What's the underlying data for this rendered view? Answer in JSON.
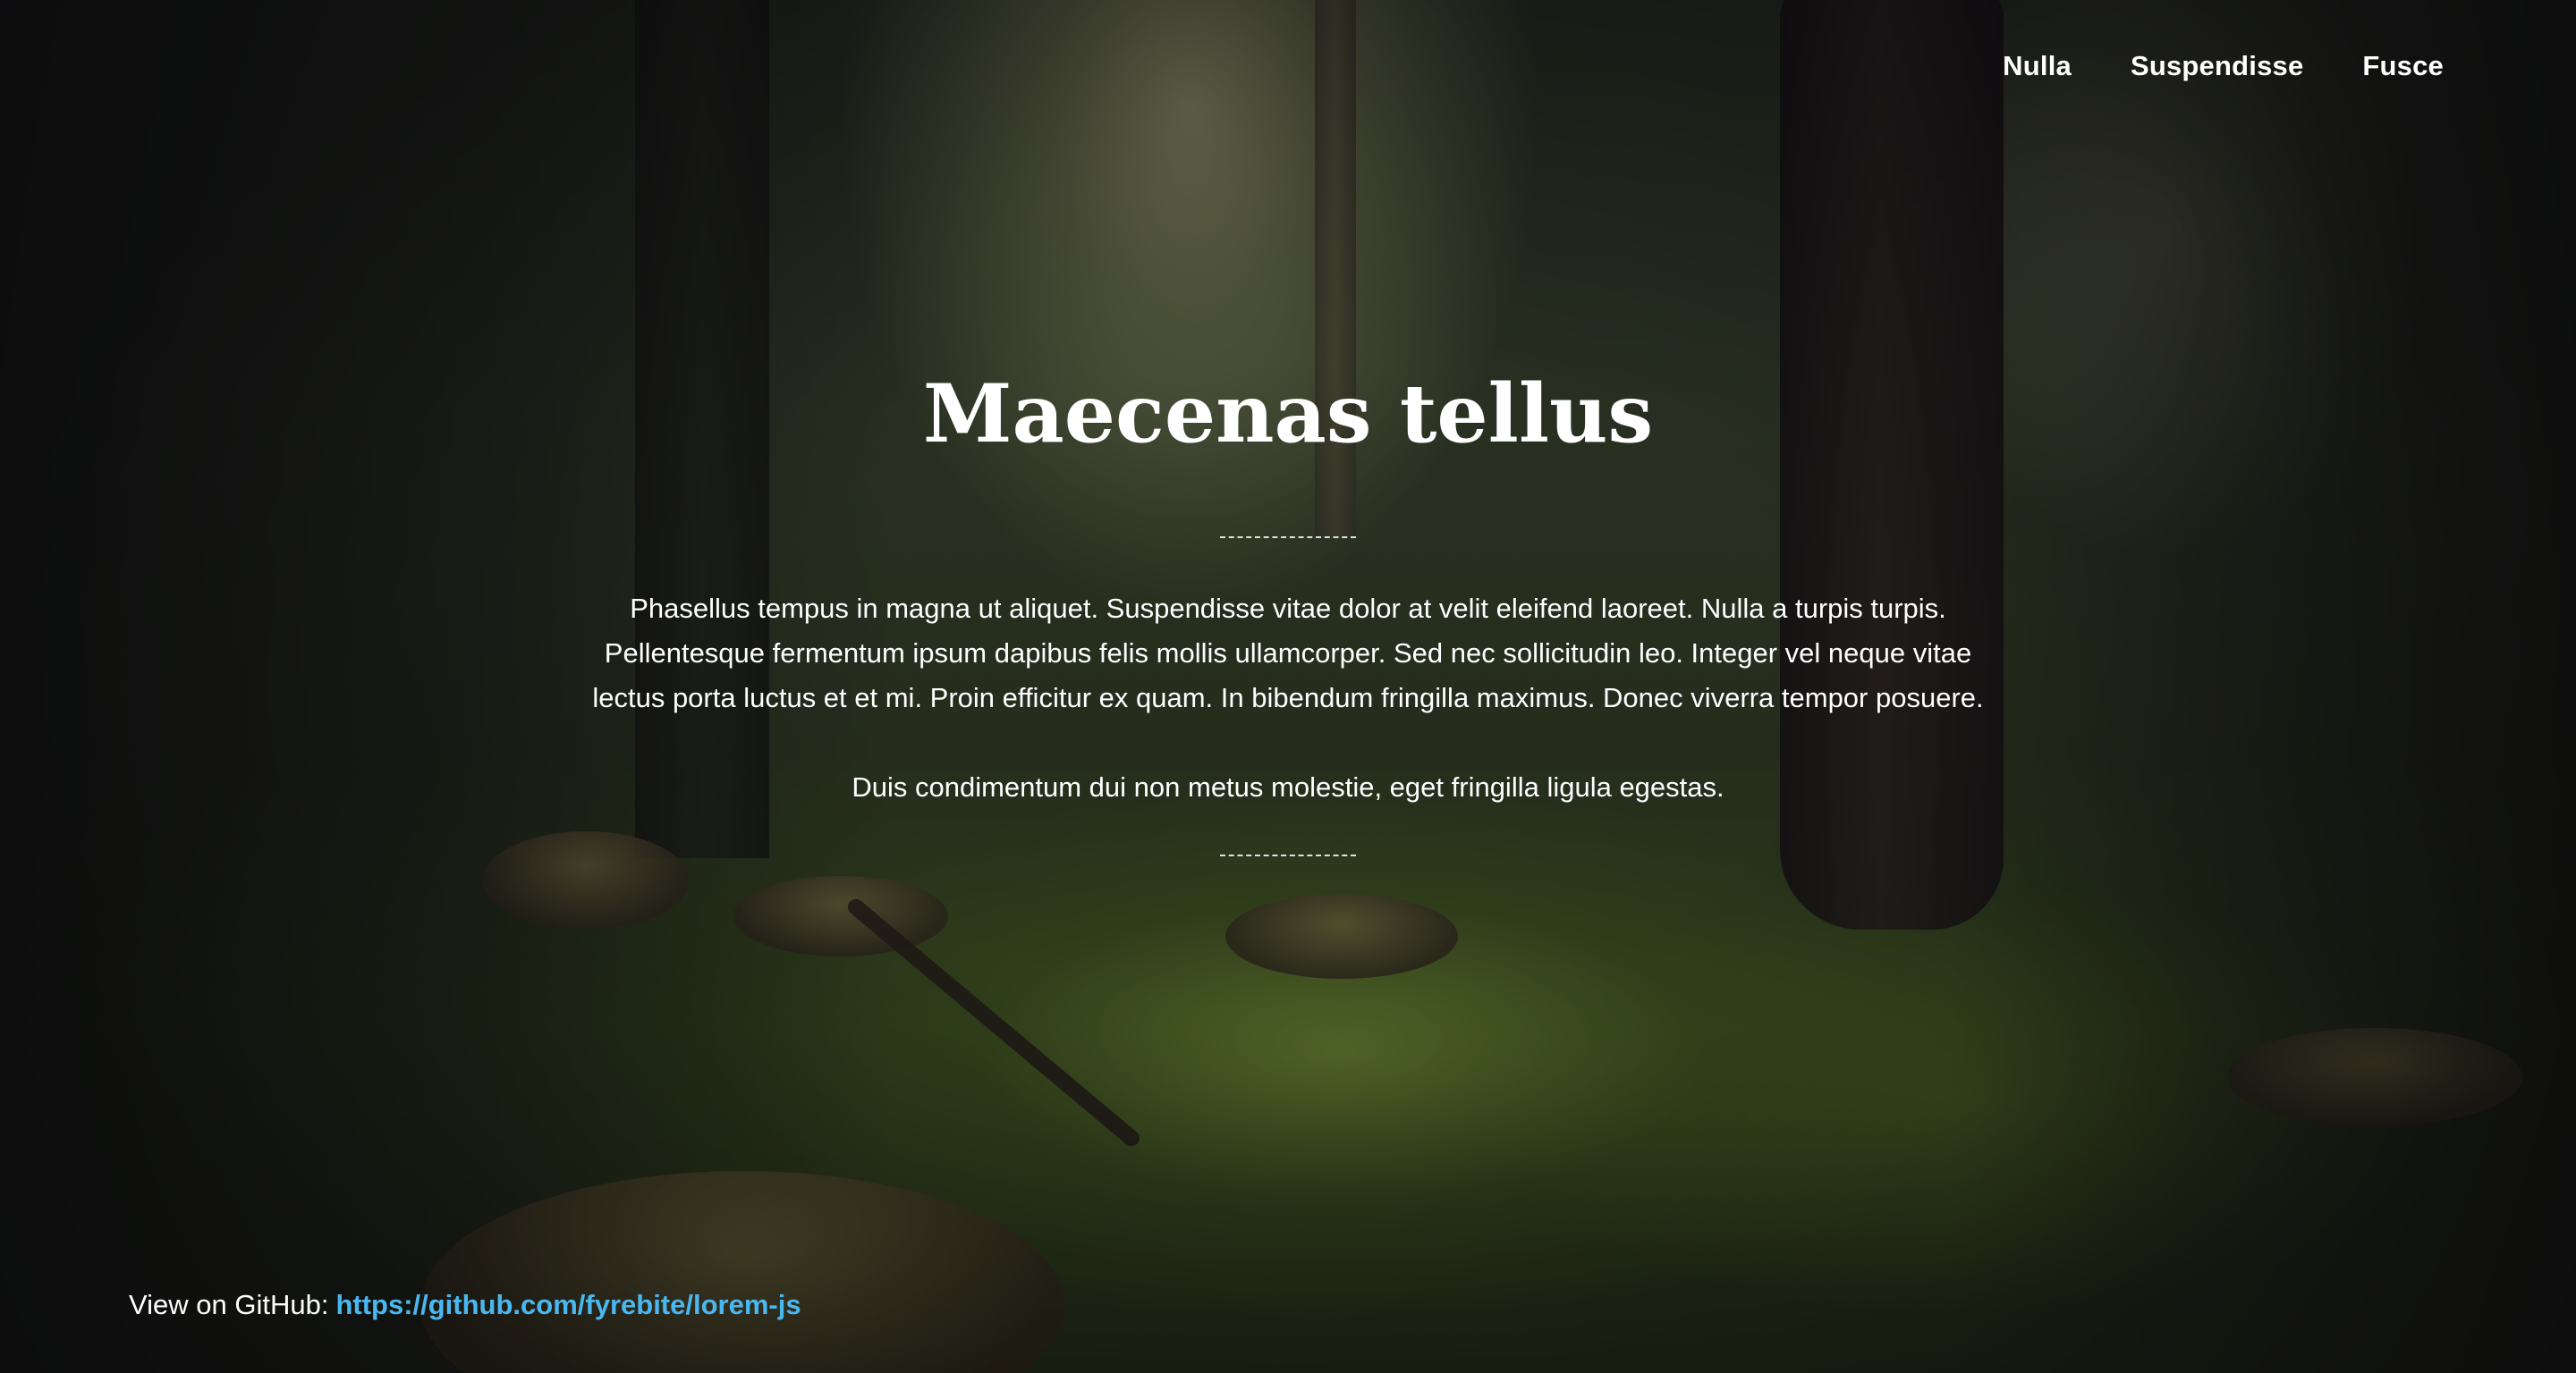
{
  "nav": {
    "items": [
      {
        "label": "Nulla"
      },
      {
        "label": "Suspendisse"
      },
      {
        "label": "Fusce"
      }
    ]
  },
  "hero": {
    "title": "Maecenas tellus",
    "paragraphs": [
      "Phasellus tempus in magna ut aliquet. Suspendisse vitae dolor at velit eleifend laoreet. Nulla a turpis turpis. Pellentesque fermentum ipsum dapibus felis mollis ullamcorper. Sed nec sollicitudin leo. Integer vel neque vitae lectus porta luctus et et mi. Proin efficitur ex quam. In bibendum fringilla maximus. Donec viverra tempor posuere.",
      "Duis condimentum dui non metus molestie, eget fringilla ligula egestas."
    ]
  },
  "footer": {
    "github_prefix": "View on GitHub:",
    "github_link": "https://github.com/fyrebite/lorem-js"
  },
  "colors": {
    "link": "#4ab8f0",
    "text": "#ffffff"
  }
}
